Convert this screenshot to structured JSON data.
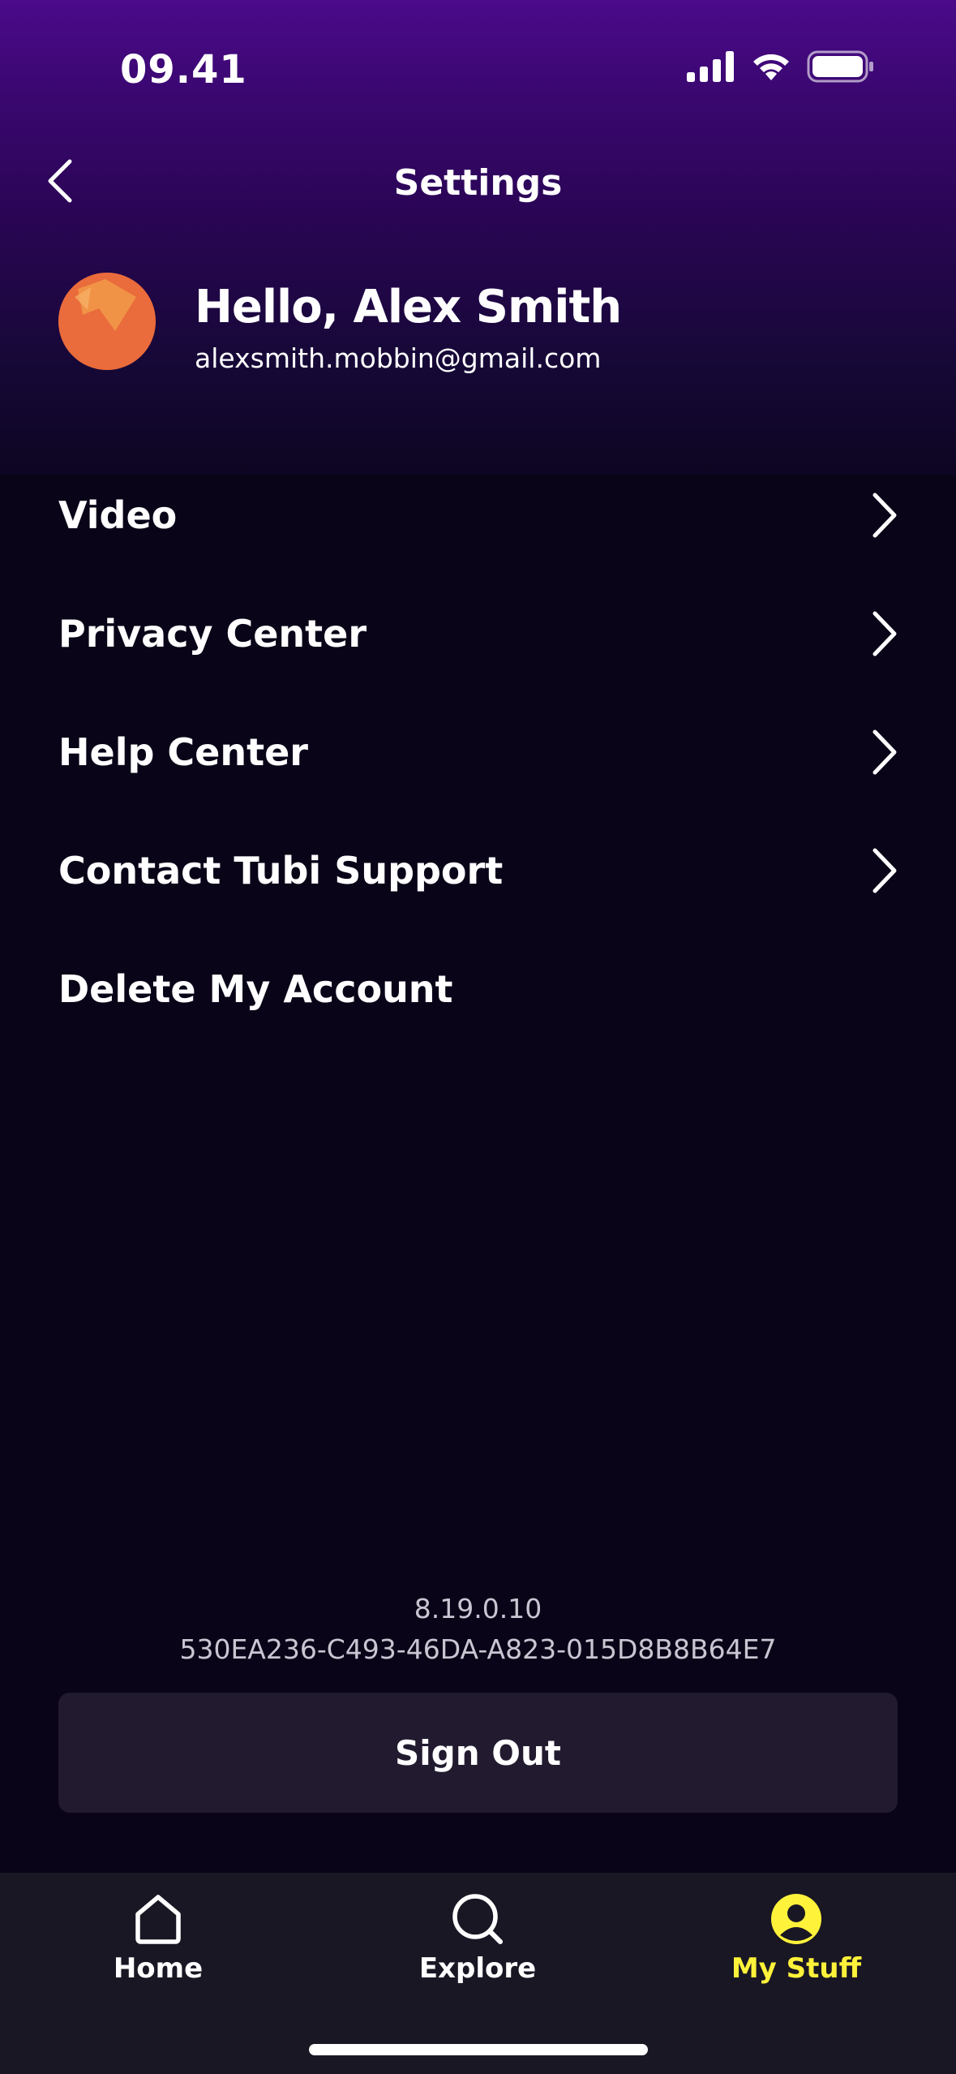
{
  "status_bar": {
    "time": "09.41"
  },
  "header": {
    "title": "Settings",
    "back_icon": "chevron-left-icon"
  },
  "profile": {
    "greeting": "Hello, Alex Smith",
    "email": "alexsmith.mobbin@gmail.com"
  },
  "menu": {
    "items": [
      {
        "label": "Video",
        "has_chevron": true
      },
      {
        "label": "Privacy Center",
        "has_chevron": true
      },
      {
        "label": "Help Center",
        "has_chevron": true
      },
      {
        "label": "Contact Tubi Support",
        "has_chevron": true
      },
      {
        "label": "Delete My Account",
        "has_chevron": false
      }
    ]
  },
  "app_info": {
    "version": "8.19.0.10",
    "device_id": "530EA236-C493-46DA-A823-015D8B8B64E7"
  },
  "actions": {
    "sign_out_label": "Sign Out"
  },
  "tab_bar": {
    "tabs": [
      {
        "label": "Home",
        "icon": "home-icon",
        "active": false
      },
      {
        "label": "Explore",
        "icon": "search-icon",
        "active": false
      },
      {
        "label": "My Stuff",
        "icon": "user-icon",
        "active": true
      }
    ]
  },
  "colors": {
    "background": "#0a0418",
    "header_gradient_top": "#4b0a8a",
    "active_tab": "#fff23a",
    "button_bg": "#221b30",
    "tab_bar_bg": "#1a1724",
    "avatar": "#ea6b3b"
  }
}
